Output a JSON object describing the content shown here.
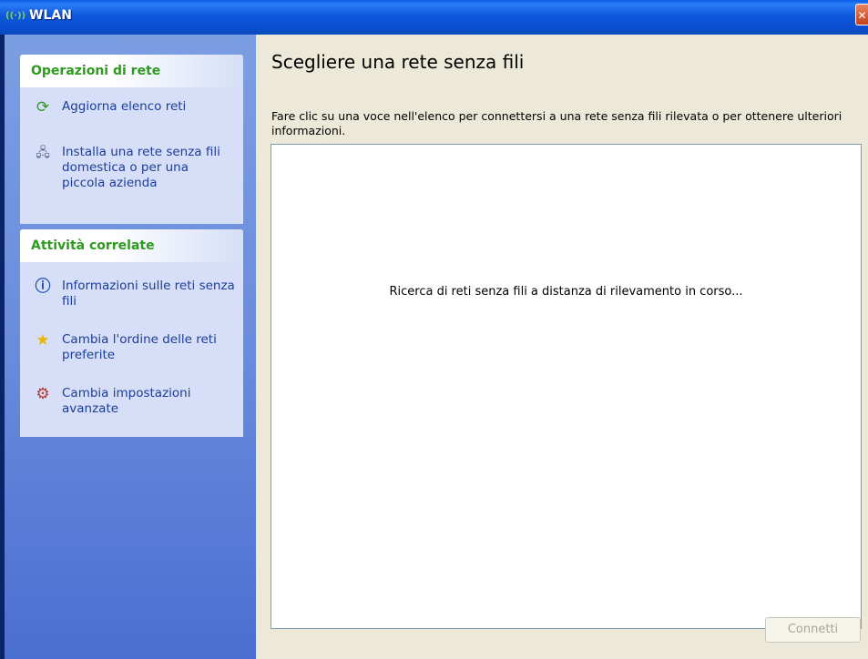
{
  "window": {
    "title": "WLAN",
    "icon": "wireless-network-icon",
    "close": "close-icon"
  },
  "sidebar": {
    "network_tasks": {
      "header": "Operazioni di rete",
      "items": [
        {
          "label": "Aggiorna elenco reti",
          "icon": "refresh-icon"
        },
        {
          "label": "Installa una rete senza fili domestica o per una piccola azienda",
          "icon": "wireless-setup-icon"
        }
      ]
    },
    "related_tasks": {
      "header": "Attività correlate",
      "items": [
        {
          "label": "Informazioni sulle reti senza fili",
          "icon": "info-icon"
        },
        {
          "label": "Cambia l'ordine delle reti preferite",
          "icon": "star-icon"
        },
        {
          "label": "Cambia impostazioni avanzate",
          "icon": "settings-icon"
        }
      ]
    }
  },
  "main": {
    "heading": "Scegliere una rete senza fili",
    "description": "Fare clic su una voce nell'elenco per connettersi a una rete senza fili rilevata o per ottenere ulteriori informazioni.",
    "list_status": "Ricerca di reti senza fili a distanza di rilevamento in corso...",
    "connect_label": "Connetti"
  },
  "colors": {
    "titlebar": "#0a4fd0",
    "sidebar": "#6a8cdc",
    "panel_header_text": "#2e9a1f",
    "link_text": "#1b3d9b",
    "content_bg": "#ece9d8"
  }
}
